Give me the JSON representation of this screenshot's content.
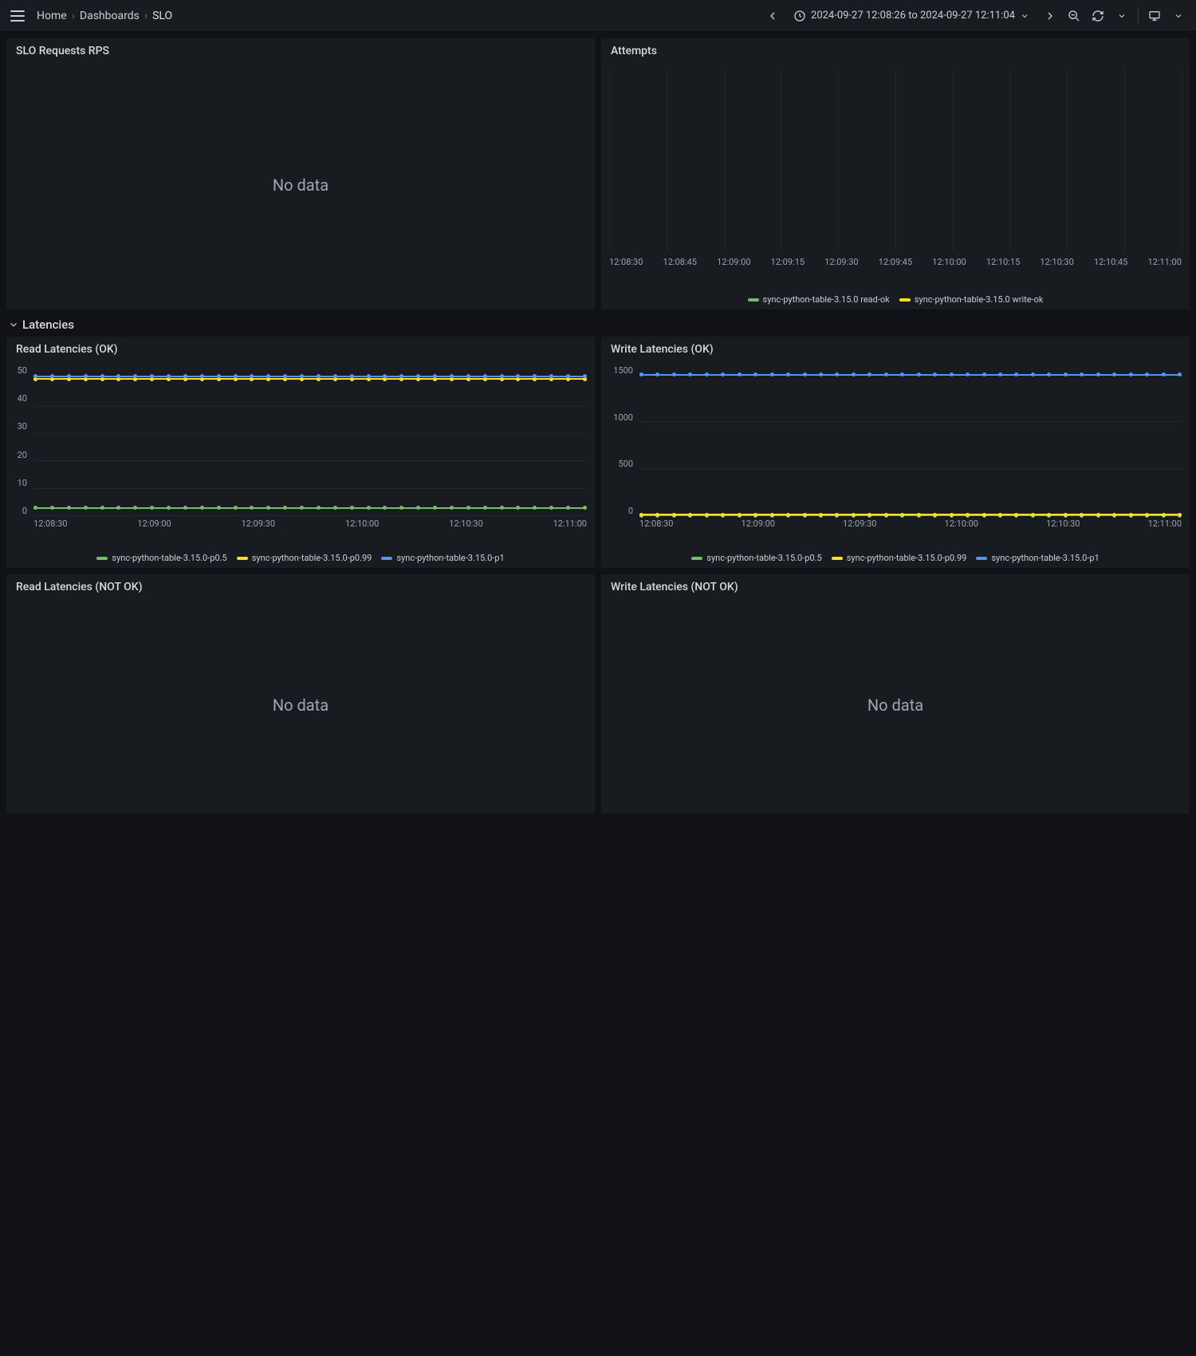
{
  "breadcrumbs": {
    "home": "Home",
    "dashboards": "Dashboards",
    "current": "SLO"
  },
  "time_range": "2024-09-27 12:08:26 to 2024-09-27 12:11:04",
  "no_data_label": "No data",
  "row_latencies": "Latencies",
  "panels": {
    "slo_rps": {
      "title": "SLO Requests RPS"
    },
    "attempts": {
      "title": "Attempts"
    },
    "read_ok": {
      "title": "Read Latencies (OK)"
    },
    "write_ok": {
      "title": "Write Latencies (OK)"
    },
    "read_notok": {
      "title": "Read Latencies (NOT OK)"
    },
    "write_notok": {
      "title": "Write Latencies (NOT OK)"
    }
  },
  "colors": {
    "green": "#73bf69",
    "yellow": "#fade2a",
    "blue": "#5794f2"
  },
  "chart_data": [
    {
      "id": "attempts",
      "type": "line",
      "title": "Attempts",
      "x_ticks": [
        "12:08:30",
        "12:08:45",
        "12:09:00",
        "12:09:15",
        "12:09:30",
        "12:09:45",
        "12:10:00",
        "12:10:15",
        "12:10:30",
        "12:10:45",
        "12:11:00"
      ],
      "y_ticks": [],
      "ylim": [
        0,
        1
      ],
      "series": [
        {
          "name": "sync-python-table-3.15.0 read-ok",
          "color": "green",
          "values": null,
          "note": "no visible data points"
        },
        {
          "name": "sync-python-table-3.15.0 write-ok",
          "color": "yellow",
          "values": null,
          "note": "no visible data points"
        }
      ]
    },
    {
      "id": "read_ok",
      "type": "line",
      "title": "Read Latencies (OK)",
      "x_ticks": [
        "12:08:30",
        "12:09:00",
        "12:09:30",
        "12:10:00",
        "12:10:30",
        "12:11:00"
      ],
      "y_ticks": [
        0,
        10,
        20,
        30,
        40,
        50
      ],
      "ylim": [
        0,
        55
      ],
      "point_count": 34,
      "series": [
        {
          "name": "sync-python-table-3.15.0-p0.5",
          "color": "green",
          "constant": 3
        },
        {
          "name": "sync-python-table-3.15.0-p0.99",
          "color": "yellow",
          "constant": 50
        },
        {
          "name": "sync-python-table-3.15.0-p1",
          "color": "blue",
          "constant": 51
        }
      ]
    },
    {
      "id": "write_ok",
      "type": "line",
      "title": "Write Latencies (OK)",
      "x_ticks": [
        "12:08:30",
        "12:09:00",
        "12:09:30",
        "12:10:00",
        "12:10:30",
        "12:11:00"
      ],
      "y_ticks": [
        0,
        500,
        1000,
        1500
      ],
      "ylim": [
        0,
        1600
      ],
      "point_count": 34,
      "series": [
        {
          "name": "sync-python-table-3.15.0-p0.5",
          "color": "green",
          "constant": 8
        },
        {
          "name": "sync-python-table-3.15.0-p0.99",
          "color": "yellow",
          "constant": 15
        },
        {
          "name": "sync-python-table-3.15.0-p1",
          "color": "blue",
          "constant": 1500
        }
      ]
    }
  ]
}
